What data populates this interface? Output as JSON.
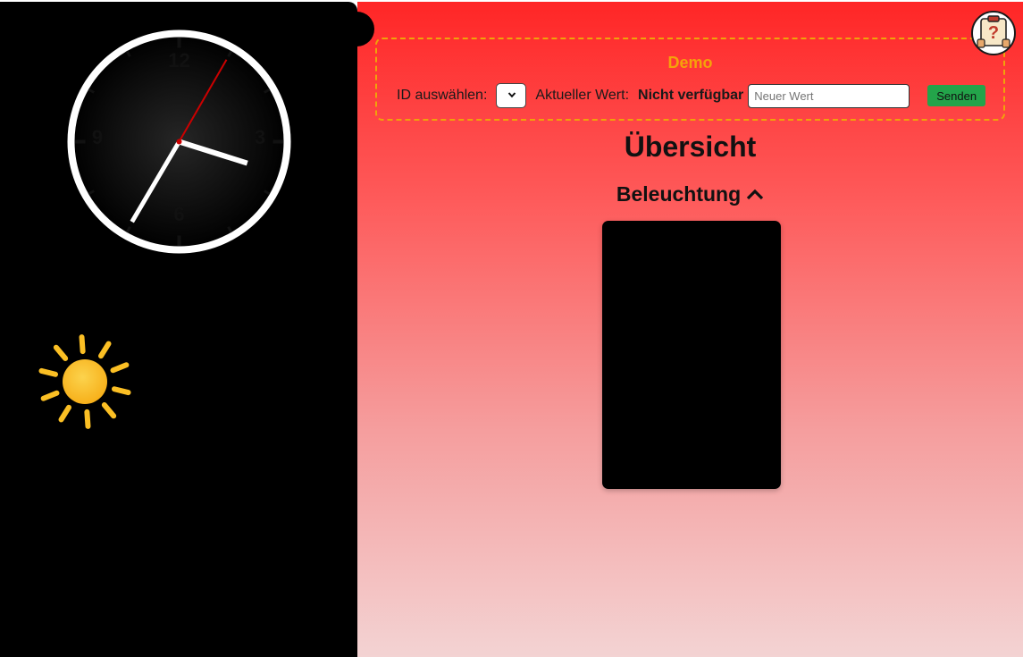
{
  "sidebar": {
    "clock": {
      "numerals": [
        "12",
        "3",
        "6",
        "9"
      ],
      "time": {
        "hours": 3,
        "minutes": 35,
        "seconds": 5
      },
      "colors": {
        "face": "#000000",
        "rim": "#ffffff",
        "hands": "#ffffff",
        "second_hand": "#cc0000"
      }
    },
    "weather_icon": "sun-icon",
    "weather_color": "#fbbf24"
  },
  "help": {
    "icon": "help-icon"
  },
  "demo": {
    "title": "Demo",
    "id_label": "ID auswählen:",
    "id_selected": "",
    "current_value_label": "Aktueller Wert:",
    "current_value": "Nicht verfügbar",
    "new_value_placeholder": "Neuer Wert",
    "send_label": "Senden"
  },
  "main": {
    "page_title": "Übersicht",
    "section": {
      "title": "Beleuchtung",
      "expanded": true
    }
  },
  "colors": {
    "accent_orange": "#f5a20a",
    "send_green": "#23a44a",
    "gradient_top": "#ff2626",
    "gradient_bottom": "#f3d3d3"
  }
}
